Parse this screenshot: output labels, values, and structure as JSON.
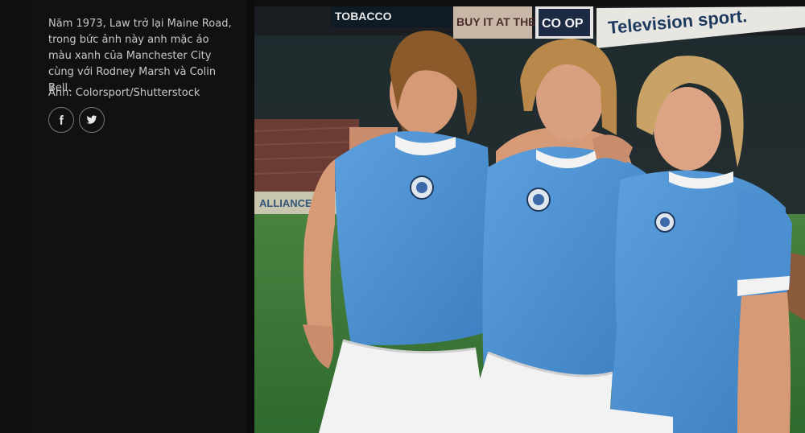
{
  "caption": {
    "text": "Năm 1973, Law trở lại Maine Road, trong bức ảnh này anh mặc áo màu xanh của Manchester City cùng với Rodney Marsh và Colin Bell.",
    "credit": "Ảnh: Colorsport/Shutterstock"
  },
  "share": [
    {
      "icon": "facebook-icon"
    },
    {
      "icon": "twitter-icon"
    }
  ],
  "photo": {
    "signage": [
      "TOBACCO",
      "BUY IT AT THE",
      "CO OP",
      "Television sport."
    ],
    "ground_sign": "ALLIANCE &"
  },
  "colors": {
    "panel_bg": "#111112",
    "text": "#c9c9c9",
    "jersey_blue": "#4a8fcf",
    "shorts_white": "#f2f2f2",
    "pitch_green": "#3f7a39"
  }
}
